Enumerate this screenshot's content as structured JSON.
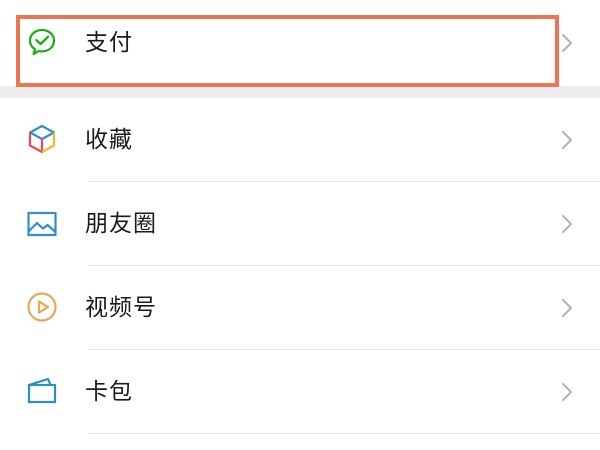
{
  "menu": {
    "items": [
      {
        "label": "支付",
        "icon": "wechat-pay-icon"
      },
      {
        "label": "收藏",
        "icon": "favorites-cube-icon"
      },
      {
        "label": "朋友圈",
        "icon": "moments-image-icon"
      },
      {
        "label": "视频号",
        "icon": "channels-play-icon"
      },
      {
        "label": "卡包",
        "icon": "card-wallet-icon"
      }
    ]
  },
  "colors": {
    "highlight_border": "#ee7552",
    "pay_green": "#1aad19",
    "section_gap": "#ededed",
    "chevron": "#b2b2b2",
    "moments_blue": "#2f8fc9",
    "channels_orange": "#e8a85a",
    "card_teal": "#2d8fbf"
  }
}
